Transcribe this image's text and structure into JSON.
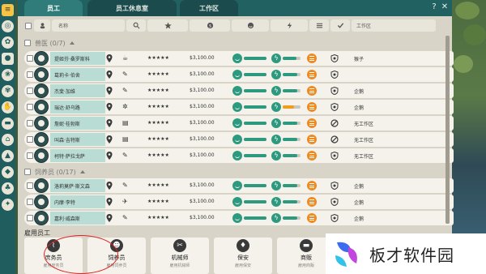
{
  "tabs": [
    {
      "label": "员工",
      "active": true
    },
    {
      "label": "员工休息室",
      "active": false
    },
    {
      "label": "工作区",
      "active": false
    }
  ],
  "window_controls": {
    "help": "?",
    "close": "✕"
  },
  "header": {
    "name_label": "名称",
    "zone_label": "工作区"
  },
  "groups": [
    {
      "title": "兽医 (0/7)",
      "rows": [
        {
          "name": "提姬芬·桑罗斯科",
          "task": "cup-icon",
          "stars": "★★★★★",
          "salary": "$3,100.00",
          "happy": 1.0,
          "energy": 0.75,
          "energy_color": "#2d9a80",
          "status": "shield-icon",
          "zone": "猴子"
        },
        {
          "name": "葛莉卡·伯舍",
          "task": "walk-icon",
          "stars": "★★★★★",
          "salary": "$3,100.00",
          "happy": 1.0,
          "energy": 0.8,
          "energy_color": "#2d9a80",
          "status": "shield-icon",
          "zone": ""
        },
        {
          "name": "杰斐·加维",
          "task": "walk-icon",
          "stars": "★★★★★",
          "salary": "$3,100.00",
          "happy": 1.0,
          "energy": 0.8,
          "energy_color": "#2d9a80",
          "status": "shield-icon",
          "zone": "企鹅"
        },
        {
          "name": "瑞达·舒乌路",
          "task": "paw-icon",
          "stars": "★★★★★",
          "salary": "$3,100.00",
          "happy": 1.0,
          "energy": 0.65,
          "energy_color": "#f09c1f",
          "status": "shield-icon",
          "zone": "企鹅"
        },
        {
          "name": "詹妮·桂勃斯",
          "task": "clipboard-icon",
          "stars": "★★★★★",
          "salary": "$3,100.00",
          "happy": 1.0,
          "energy": 0.8,
          "energy_color": "#2d9a80",
          "status": "forbidden-icon",
          "zone": "无工作区"
        },
        {
          "name": "叫森·吉特斯",
          "task": "clipboard-icon",
          "stars": "★★★★★",
          "salary": "$3,100.00",
          "happy": 1.0,
          "energy": 0.8,
          "energy_color": "#2d9a80",
          "status": "forbidden-icon",
          "zone": "无工作区"
        },
        {
          "name": "柯特·萨拉戈萨",
          "task": "walk-icon",
          "stars": "★★★★★",
          "salary": "$3,100.00",
          "happy": 1.0,
          "energy": 0.8,
          "energy_color": "#2d9a80",
          "status": "shield-icon",
          "zone": "无工作区"
        }
      ]
    },
    {
      "title": "饲养员 (0/17)",
      "rows": [
        {
          "name": "洛莉莫萨·斯文森",
          "task": "walk-icon",
          "stars": "★★★★★",
          "salary": "$3,100.00",
          "happy": 1.0,
          "energy": 0.8,
          "energy_color": "#2d9a80",
          "status": "shield-icon",
          "zone": "企鹅"
        },
        {
          "name": "内摩·李特",
          "task": "bird-icon",
          "stars": "★★★★★",
          "salary": "$3,100.00",
          "happy": 1.0,
          "energy": 0.8,
          "energy_color": "#2d9a80",
          "status": "shield-icon",
          "zone": "企鹅"
        },
        {
          "name": "嘉利·威森斯",
          "task": "walk-icon",
          "stars": "★★★★★",
          "salary": "$3,100.00",
          "happy": 1.0,
          "energy": 0.8,
          "energy_color": "#2d9a80",
          "status": "shield-icon",
          "zone": "企鹅"
        }
      ]
    }
  ],
  "hire": {
    "title": "雇用员工",
    "cards": [
      {
        "label": "庶务员",
        "sub": "雇用庶务员",
        "icon": "broom-icon"
      },
      {
        "label": "饲养员",
        "sub": "雇用饲养员",
        "icon": "keeper-icon"
      },
      {
        "label": "机械师",
        "sub": "雇用机械师",
        "icon": "wrench-icon"
      },
      {
        "label": "保安",
        "sub": "雇用保安",
        "icon": "security-icon"
      },
      {
        "label": "商贩",
        "sub": "雇用商贩",
        "icon": "vendor-icon"
      }
    ]
  },
  "watermark": {
    "text": "板才软件园"
  },
  "colors": {
    "accent": "#2d9a80",
    "orange": "#ef8a1f",
    "tab_bg": "#226161",
    "name_cell": "#b9dcd4"
  }
}
